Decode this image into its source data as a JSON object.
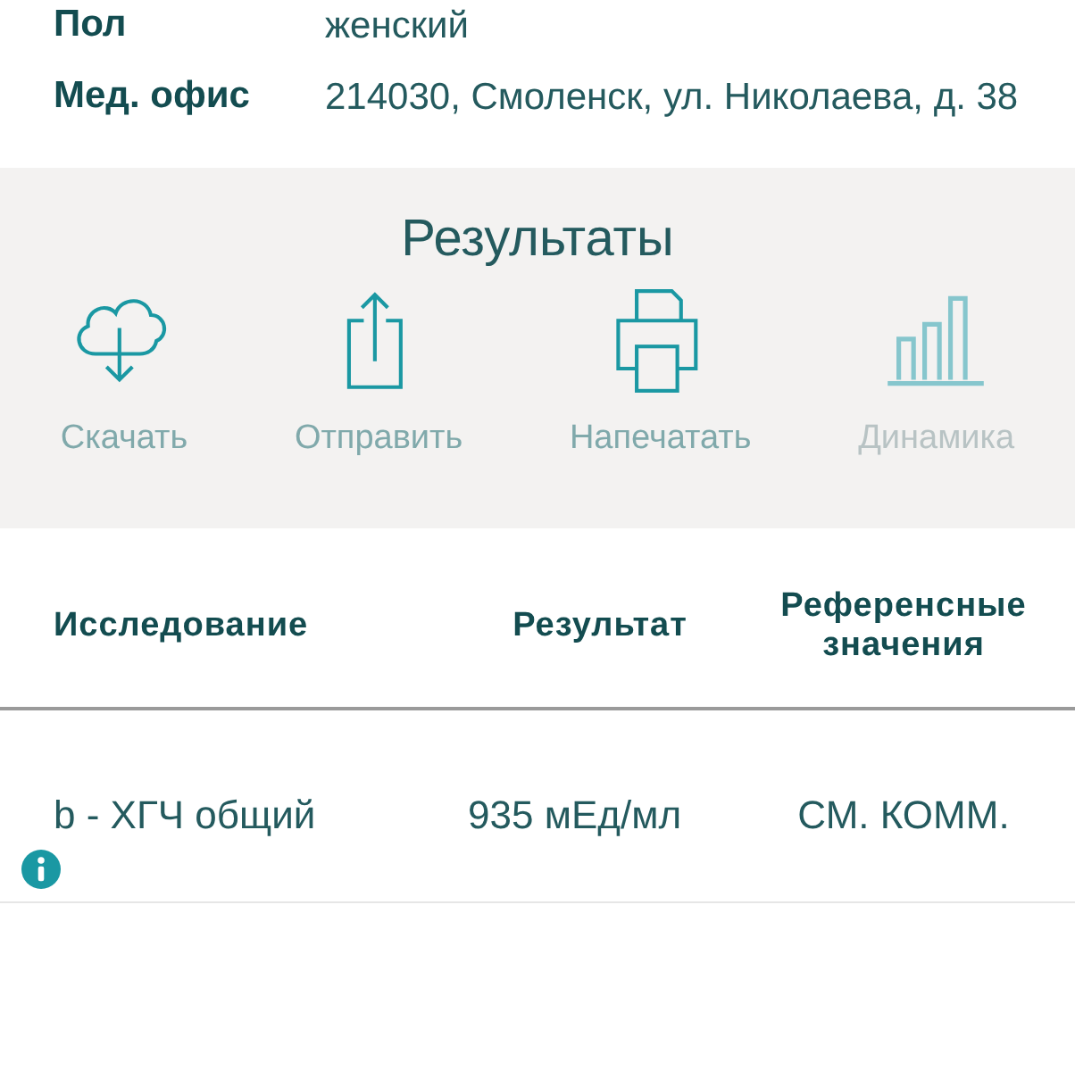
{
  "patient_info": [
    {
      "label": "Пол",
      "value": "женский"
    },
    {
      "label": "Мед. офис",
      "value": "214030, Смоленск, ул. Николаева, д. 38"
    }
  ],
  "results": {
    "title": "Результаты",
    "actions": [
      {
        "kind": "download",
        "label": "Скачать",
        "disabled": false
      },
      {
        "kind": "share",
        "label": "Отправить",
        "disabled": false
      },
      {
        "kind": "print",
        "label": "Напечатать",
        "disabled": false
      },
      {
        "kind": "chart",
        "label": "Динамика",
        "disabled": true
      }
    ]
  },
  "table": {
    "columns": [
      "Исследование",
      "Результат",
      "Референсные значения"
    ],
    "rows": [
      {
        "cells": [
          "b - ХГЧ общий",
          "935 мЕд/мл",
          "СМ. КОММ."
        ],
        "info": true
      }
    ]
  }
}
